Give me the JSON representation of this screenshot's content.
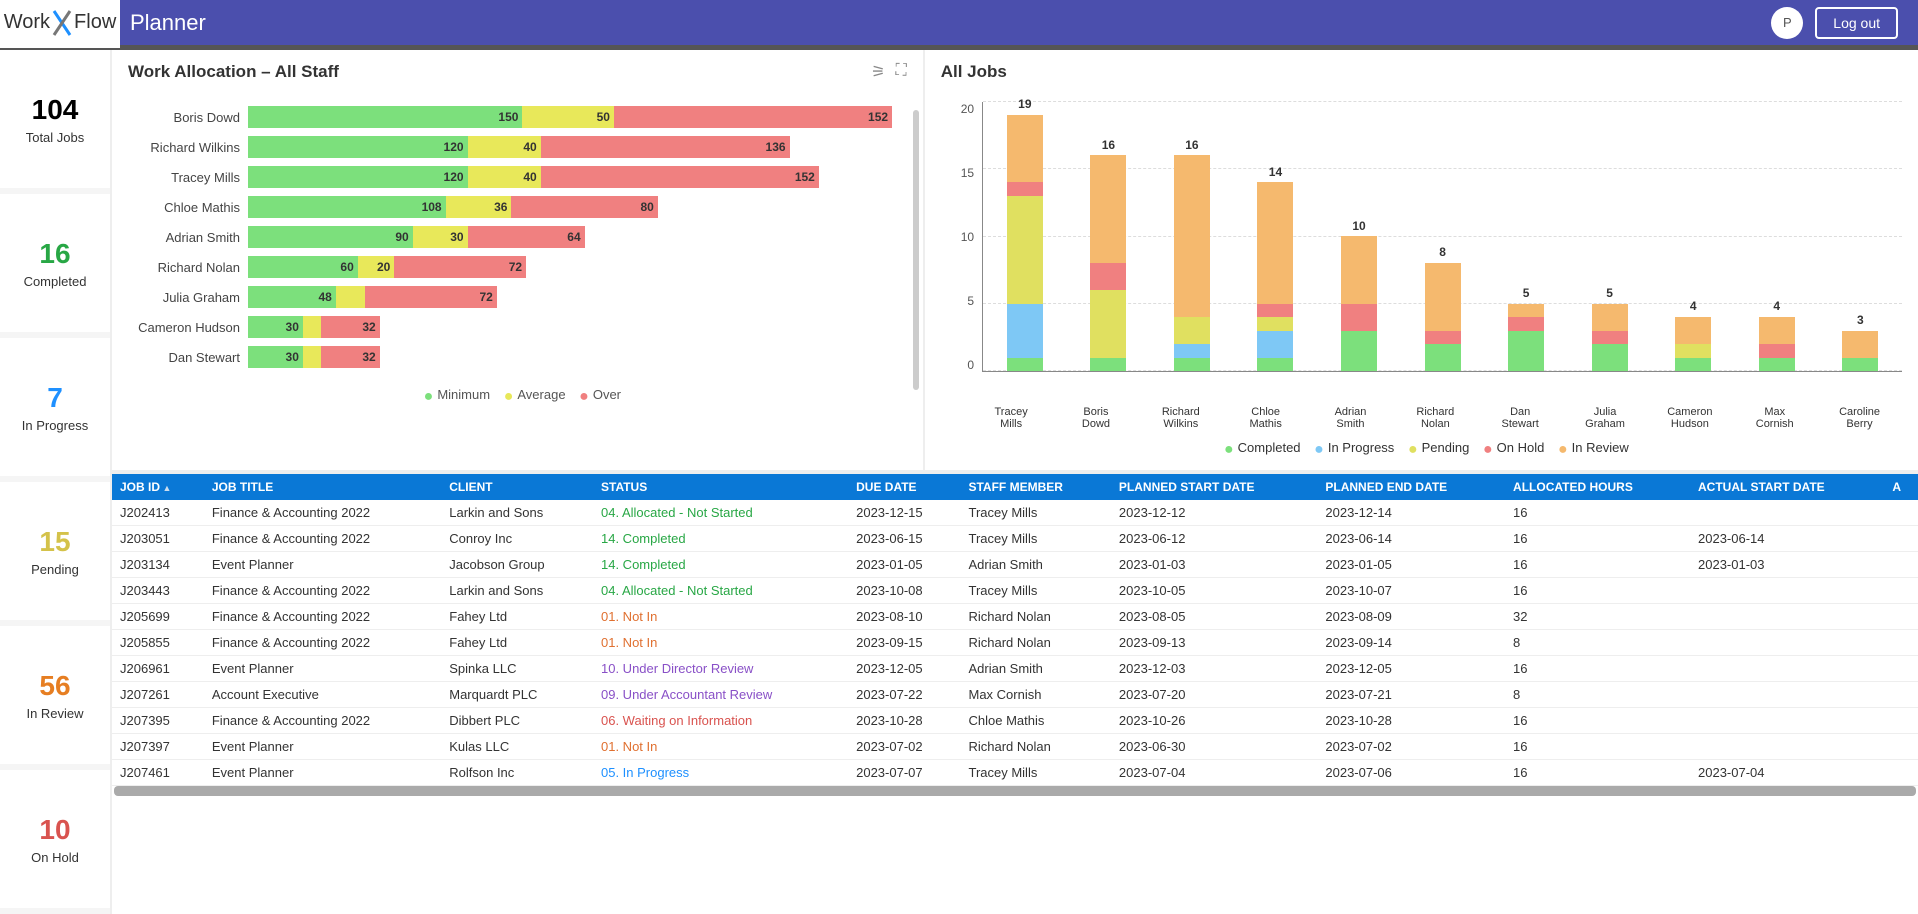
{
  "app": {
    "name_left": "Work",
    "name_right": "Flow",
    "title": "Planner",
    "avatar_initial": "P",
    "logout": "Log out"
  },
  "summary": [
    {
      "key": "total",
      "value": "104",
      "label": "Total Jobs"
    },
    {
      "key": "completed",
      "value": "16",
      "label": "Completed"
    },
    {
      "key": "inprogress",
      "value": "7",
      "label": "In Progress"
    },
    {
      "key": "pending",
      "value": "15",
      "label": "Pending"
    },
    {
      "key": "inreview",
      "value": "56",
      "label": "In Review"
    },
    {
      "key": "onhold",
      "value": "10",
      "label": "On Hold"
    }
  ],
  "work_alloc": {
    "title": "Work Allocation – All Staff",
    "legend": [
      "Minimum",
      "Average",
      "Over"
    ]
  },
  "all_jobs": {
    "title": "All Jobs",
    "legend": [
      "Completed",
      "In Progress",
      "Pending",
      "On Hold",
      "In Review"
    ],
    "y_ticks": [
      "20",
      "15",
      "10",
      "5",
      "0"
    ]
  },
  "chart_data": [
    {
      "id": "work_allocation",
      "type": "bar",
      "orientation": "horizontal",
      "stacked": true,
      "title": "Work Allocation – All Staff",
      "categories": [
        "Boris Dowd",
        "Richard Wilkins",
        "Tracey Mills",
        "Chloe Mathis",
        "Adrian Smith",
        "Richard Nolan",
        "Julia Graham",
        "Cameron Hudson",
        "Dan Stewart"
      ],
      "series": [
        {
          "name": "Minimum",
          "values": [
            150,
            120,
            120,
            108,
            90,
            60,
            48,
            30,
            30
          ]
        },
        {
          "name": "Average",
          "values": [
            50,
            40,
            40,
            36,
            30,
            20,
            16,
            10,
            10
          ]
        },
        {
          "name": "Over",
          "values": [
            152,
            136,
            152,
            80,
            64,
            72,
            72,
            32,
            32
          ]
        }
      ],
      "xlabel": "",
      "ylabel": "",
      "xlim": [
        0,
        360
      ]
    },
    {
      "id": "all_jobs",
      "type": "bar",
      "orientation": "vertical",
      "stacked": true,
      "title": "All Jobs",
      "categories": [
        "Tracey Mills",
        "Boris Dowd",
        "Richard Wilkins",
        "Chloe Mathis",
        "Adrian Smith",
        "Richard Nolan",
        "Dan Stewart",
        "Julia Graham",
        "Cameron Hudson",
        "Max Cornish",
        "Caroline Berry"
      ],
      "series": [
        {
          "name": "Completed",
          "values": [
            1,
            1,
            1,
            1,
            3,
            2,
            3,
            2,
            1,
            1,
            1
          ]
        },
        {
          "name": "In Progress",
          "values": [
            4,
            0,
            1,
            2,
            0,
            0,
            0,
            0,
            0,
            0,
            0
          ]
        },
        {
          "name": "Pending",
          "values": [
            8,
            5,
            2,
            1,
            0,
            0,
            0,
            0,
            1,
            0,
            0
          ]
        },
        {
          "name": "On Hold",
          "values": [
            1,
            2,
            0,
            1,
            2,
            1,
            1,
            1,
            0,
            1,
            0
          ]
        },
        {
          "name": "In Review",
          "values": [
            5,
            8,
            12,
            9,
            5,
            5,
            1,
            2,
            2,
            2,
            2
          ]
        }
      ],
      "totals": [
        19,
        16,
        16,
        14,
        10,
        8,
        5,
        5,
        4,
        4,
        3
      ],
      "ylabel": "",
      "xlabel": "",
      "ylim": [
        0,
        20
      ]
    }
  ],
  "table": {
    "columns": [
      "JOB ID",
      "JOB TITLE",
      "CLIENT",
      "STATUS",
      "DUE DATE",
      "STAFF MEMBER",
      "PLANNED START DATE",
      "PLANNED END DATE",
      "ALLOCATED HOURS",
      "ACTUAL START DATE",
      "A"
    ],
    "rows": [
      {
        "id": "J202413",
        "title": "Finance & Accounting 2022",
        "client": "Larkin and Sons",
        "status": "04. Allocated - Not Started",
        "st": "04",
        "due": "2023-12-15",
        "staff": "Tracey Mills",
        "pstart": "2023-12-12",
        "pend": "2023-12-14",
        "hours": "16",
        "astart": ""
      },
      {
        "id": "J203051",
        "title": "Finance & Accounting 2022",
        "client": "Conroy Inc",
        "status": "14. Completed",
        "st": "14",
        "due": "2023-06-15",
        "staff": "Tracey Mills",
        "pstart": "2023-06-12",
        "pend": "2023-06-14",
        "hours": "16",
        "astart": "2023-06-14"
      },
      {
        "id": "J203134",
        "title": "Event Planner",
        "client": "Jacobson Group",
        "status": "14. Completed",
        "st": "14",
        "due": "2023-01-05",
        "staff": "Adrian Smith",
        "pstart": "2023-01-03",
        "pend": "2023-01-05",
        "hours": "16",
        "astart": "2023-01-03"
      },
      {
        "id": "J203443",
        "title": "Finance & Accounting 2022",
        "client": "Larkin and Sons",
        "status": "04. Allocated - Not Started",
        "st": "04",
        "due": "2023-10-08",
        "staff": "Tracey Mills",
        "pstart": "2023-10-05",
        "pend": "2023-10-07",
        "hours": "16",
        "astart": ""
      },
      {
        "id": "J205699",
        "title": "Finance & Accounting 2022",
        "client": "Fahey Ltd",
        "status": "01. Not In",
        "st": "01",
        "due": "2023-08-10",
        "staff": "Richard Nolan",
        "pstart": "2023-08-05",
        "pend": "2023-08-09",
        "hours": "32",
        "astart": ""
      },
      {
        "id": "J205855",
        "title": "Finance & Accounting 2022",
        "client": "Fahey Ltd",
        "status": "01. Not In",
        "st": "01",
        "due": "2023-09-15",
        "staff": "Richard Nolan",
        "pstart": "2023-09-13",
        "pend": "2023-09-14",
        "hours": "8",
        "astart": ""
      },
      {
        "id": "J206961",
        "title": "Event Planner",
        "client": "Spinka LLC",
        "status": "10. Under Director Review",
        "st": "10",
        "due": "2023-12-05",
        "staff": "Adrian Smith",
        "pstart": "2023-12-03",
        "pend": "2023-12-05",
        "hours": "16",
        "astart": ""
      },
      {
        "id": "J207261",
        "title": "Account Executive",
        "client": "Marquardt PLC",
        "status": "09. Under Accountant Review",
        "st": "09",
        "due": "2023-07-22",
        "staff": "Max Cornish",
        "pstart": "2023-07-20",
        "pend": "2023-07-21",
        "hours": "8",
        "astart": ""
      },
      {
        "id": "J207395",
        "title": "Finance & Accounting 2022",
        "client": "Dibbert PLC",
        "status": "06. Waiting on Information",
        "st": "06",
        "due": "2023-10-28",
        "staff": "Chloe Mathis",
        "pstart": "2023-10-26",
        "pend": "2023-10-28",
        "hours": "16",
        "astart": ""
      },
      {
        "id": "J207397",
        "title": "Event Planner",
        "client": "Kulas LLC",
        "status": "01. Not In",
        "st": "01",
        "due": "2023-07-02",
        "staff": "Richard Nolan",
        "pstart": "2023-06-30",
        "pend": "2023-07-02",
        "hours": "16",
        "astart": ""
      },
      {
        "id": "J207461",
        "title": "Event Planner",
        "client": "Rolfson Inc",
        "status": "05. In Progress",
        "st": "05",
        "due": "2023-07-07",
        "staff": "Tracey Mills",
        "pstart": "2023-07-04",
        "pend": "2023-07-06",
        "hours": "16",
        "astart": "2023-07-04"
      }
    ]
  }
}
